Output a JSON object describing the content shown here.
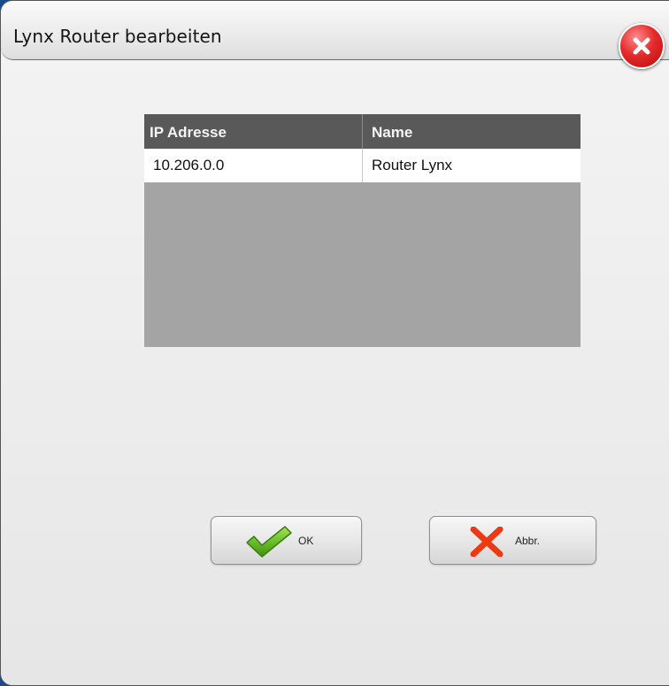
{
  "dialog": {
    "title": "Lynx Router bearbeiten"
  },
  "icons": {
    "close": "close-icon",
    "ok": "checkmark-icon",
    "cancel": "x-icon"
  },
  "table": {
    "columns": [
      "IP Adresse",
      "Name"
    ],
    "rows": [
      {
        "ip": "10.206.0.0",
        "name": "Router Lynx"
      }
    ]
  },
  "buttons": {
    "ok_label": "OK",
    "cancel_label": "Abbr."
  },
  "colors": {
    "accent_green": "#6abf2a",
    "cancel_red": "#ee3a12",
    "close_red": "#d41f1f",
    "header_gray": "#595959"
  }
}
